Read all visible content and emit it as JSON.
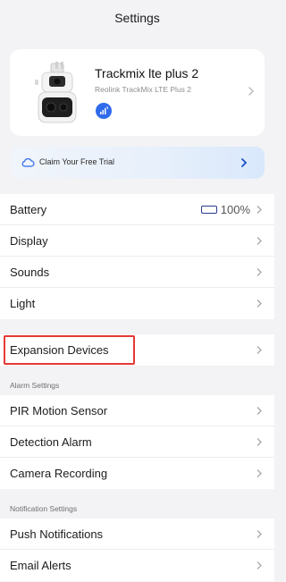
{
  "header": {
    "title": "Settings"
  },
  "device": {
    "name": "Trackmix lte plus 2",
    "model": "Reolink TrackMix LTE Plus 2"
  },
  "trial": {
    "label": "Claim Your Free Trial"
  },
  "general": {
    "battery": {
      "label": "Battery",
      "value": "100%",
      "level_percent": 100
    },
    "display": "Display",
    "sounds": "Sounds",
    "light": "Light"
  },
  "expansion": {
    "label": "Expansion Devices"
  },
  "alarm": {
    "section_title": "Alarm Settings",
    "items": [
      "PIR Motion Sensor",
      "Detection Alarm",
      "Camera Recording"
    ]
  },
  "notification": {
    "section_title": "Notification Settings",
    "items": [
      "Push Notifications",
      "Email Alerts"
    ]
  },
  "colors": {
    "accent_blue": "#2f6bea",
    "highlight_red": "#e53935",
    "battery_blue": "#2348d8"
  },
  "icons": {
    "device_card": [
      "camera-icon",
      "signal-icon",
      "chevron-right-icon"
    ],
    "trial": [
      "cloud-icon",
      "chevron-right-icon"
    ],
    "rows": "chevron-right-icon",
    "battery": "battery-icon"
  }
}
